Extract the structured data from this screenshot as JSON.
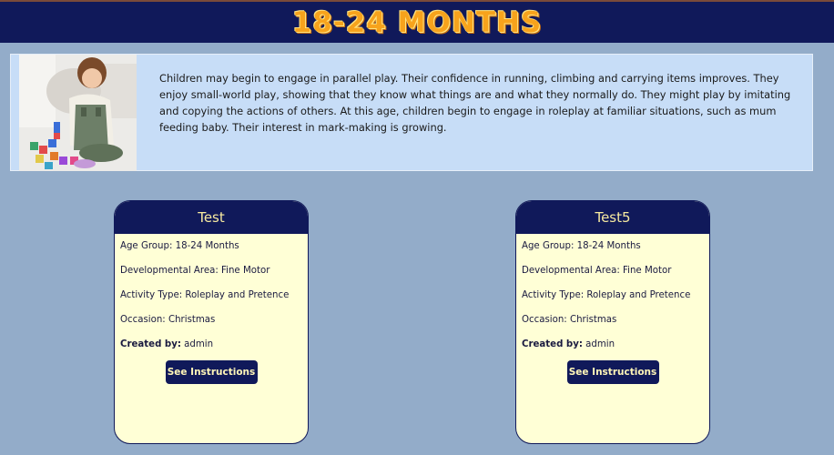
{
  "header": {
    "title": "18-24 MONTHS"
  },
  "intro": {
    "text": "Children may begin to engage in parallel play. Their confidence in running, climbing and carrying items improves. They enjoy small-world play, showing that they know what things are and what they normally do. They might play by imitating and copying the actions of others. At this age, children begin to engage in roleplay at familiar situations, such as mum feeding baby. Their interest in mark-making is growing."
  },
  "cards": [
    {
      "title": "Test",
      "age_group_label": "Age Group:",
      "age_group": "18-24 Months",
      "dev_area_label": "Developmental Area:",
      "dev_area": "Fine Motor",
      "activity_type_label": "Activity Type:",
      "activity_type": "Roleplay and Pretence",
      "occasion_label": "Occasion:",
      "occasion": "Christmas",
      "created_by_label": "Created by:",
      "created_by": "admin",
      "button_label": "See Instructions"
    },
    {
      "title": "Test5",
      "age_group_label": "Age Group:",
      "age_group": "18-24 Months",
      "dev_area_label": "Developmental Area:",
      "dev_area": "Fine Motor",
      "activity_type_label": "Activity Type:",
      "activity_type": "Roleplay and Pretence",
      "occasion_label": "Occasion:",
      "occasion": "Christmas",
      "created_by_label": "Created by:",
      "created_by": "admin",
      "button_label": "See Instructions"
    }
  ],
  "colors": {
    "page_bg": "#93acc9",
    "navy": "#10195a",
    "title_orange": "#f7a31c",
    "card_bg": "#ffffd6",
    "intro_bg": "#c7ddf7"
  }
}
